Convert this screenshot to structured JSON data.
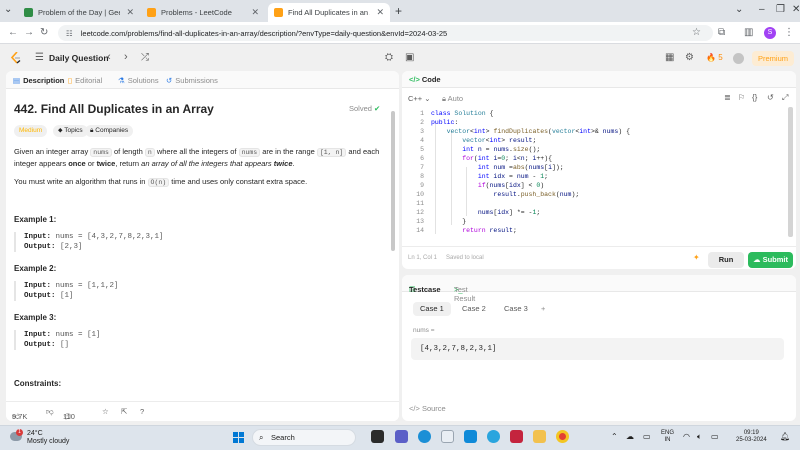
{
  "browser": {
    "tabs": [
      {
        "title": "Problem of the Day | GeeksforG",
        "favicon_color": "#2f8d46",
        "active": false
      },
      {
        "title": "Problems - LeetCode",
        "favicon_color": "#ffa116",
        "active": false
      },
      {
        "title": "Find All Duplicates in an Array",
        "favicon_color": "#ffa116",
        "active": true
      }
    ],
    "new_tab": "+",
    "url": "leetcode.com/problems/find-all-duplicates-in-an-array/description/?envType=daily-question&envId=2024-03-25",
    "profile_initial": "S"
  },
  "leetcode_bar": {
    "daily_label": "Daily Question",
    "streak_count": "5",
    "premium_label": "Premium"
  },
  "left_panel": {
    "tabs": [
      {
        "label": "Description",
        "icon": "document-icon"
      },
      {
        "label": "Editorial",
        "icon": "book-icon"
      },
      {
        "label": "Solutions",
        "icon": "flask-icon"
      },
      {
        "label": "Submissions",
        "icon": "history-icon"
      }
    ],
    "title": "442. Find All Duplicates in an Array",
    "solved_label": "Solved",
    "chips": {
      "difficulty": "Medium",
      "topics": "Topics",
      "companies": "Companies"
    },
    "description": {
      "p1_a": "Given an integer array ",
      "p1_code1": "nums",
      "p1_b": " of length ",
      "p1_code2": "n",
      "p1_c": " where all the integers of ",
      "p1_code3": "nums",
      "p1_d": " are in the range ",
      "p1_code4": "[1, n]",
      "p1_e": " and each integer appears ",
      "p1_once": "once",
      "p1_f": " or ",
      "p1_twice": "twice",
      "p1_g": ", return ",
      "p1_italic": "an array of all the integers that appears ",
      "p1_twice2": "twice",
      "p1_end": ".",
      "p2_a": "You must write an algorithm that runs in ",
      "p2_code": "O(n)",
      "p2_b": " time and uses only constant extra space."
    },
    "examples": [
      {
        "title": "Example 1:",
        "input_label": "Input:",
        "input": "nums = [4,3,2,7,8,2,3,1]",
        "output_label": "Output:",
        "output": "[2,3]"
      },
      {
        "title": "Example 2:",
        "input_label": "Input:",
        "input": "nums = [1,1,2]",
        "output_label": "Output:",
        "output": "[1]"
      },
      {
        "title": "Example 3:",
        "input_label": "Input:",
        "input": "nums = [1]",
        "output_label": "Output:",
        "output": "[]"
      }
    ],
    "constraints_title": "Constraints:",
    "footer": {
      "likes": "9.7K",
      "comments": "110"
    }
  },
  "code_panel": {
    "title": "Code",
    "language": "C++",
    "mode": "Auto",
    "line_numbers": [
      "1",
      "2",
      "3",
      "4",
      "5",
      "6",
      "7",
      "8",
      "9",
      "10",
      "11",
      "12",
      "13",
      "14"
    ],
    "status_position": "Ln 1, Col 1",
    "status_saved": "Saved to local",
    "run_label": "Run",
    "submit_label": "Submit"
  },
  "testcase_panel": {
    "tab_testcase": "Testcase",
    "tab_result": "Test Result",
    "cases": [
      "Case 1",
      "Case 2",
      "Case 3"
    ],
    "add_case": "+",
    "input_label": "nums =",
    "input_value": "[4,3,2,7,8,2,3,1]",
    "source_label": "Source"
  },
  "taskbar": {
    "temperature": "24°C",
    "weather": "Mostly cloudy",
    "weather_badge": "1",
    "search_placeholder": "Search",
    "lang_line1": "ENG",
    "lang_line2": "IN",
    "time": "09:19",
    "date": "25-03-2024"
  },
  "colors": {
    "accent_green": "#2cbb5d",
    "brand_orange": "#ffa116",
    "medium_yellow": "#ffb800"
  }
}
